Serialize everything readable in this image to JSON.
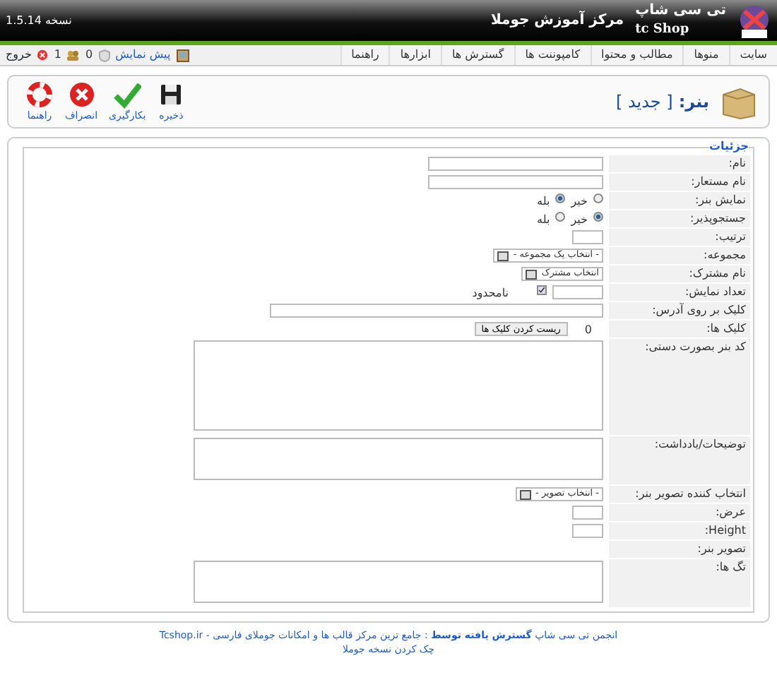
{
  "header": {
    "brand": "تی سی شاپ",
    "brand_latin": "tc Shop",
    "site": "مرکز آموزش جوملا",
    "version": "نسخه 1.5.14"
  },
  "menu": [
    "سایت",
    "منوها",
    "مطالب و محتوا",
    "کامپوننت ها",
    "گسترش ها",
    "ابزارها",
    "راهنما"
  ],
  "status": {
    "preview": "پیش نمایش",
    "messages": "0",
    "users": "1",
    "logout": "خروج"
  },
  "toolbar": {
    "title": "بنر:",
    "subtitle": "[ جدید ]",
    "buttons": [
      {
        "label": "ذخیره",
        "kind": "save"
      },
      {
        "label": "بکارگیری",
        "kind": "apply"
      },
      {
        "label": "انصراف",
        "kind": "cancel"
      },
      {
        "label": "راهنما",
        "kind": "help"
      }
    ]
  },
  "form": {
    "legend": "جزئیات",
    "rows": [
      {
        "kind": "text",
        "label": "نام:"
      },
      {
        "kind": "text",
        "label": "نام مستعار:"
      },
      {
        "kind": "radio",
        "label": "نمایش بنر:",
        "options": [
          {
            "label": "خیر",
            "selected": false
          },
          {
            "label": "بله",
            "selected": true
          }
        ]
      },
      {
        "kind": "radio",
        "label": "جستجوپذیر:",
        "options": [
          {
            "label": "خیر",
            "selected": true
          },
          {
            "label": "بله",
            "selected": false
          }
        ]
      },
      {
        "kind": "short",
        "label": "ترتیب:"
      },
      {
        "kind": "select",
        "label": "مجموعه:",
        "value": "- انتخاب یک مجموعه -"
      },
      {
        "kind": "select",
        "label": "نام مشترک:",
        "value": "انتخاب مشترک"
      },
      {
        "kind": "limit",
        "label": "تعداد نمایش:",
        "check_label": "نامحدود",
        "checked": true
      },
      {
        "kind": "wide",
        "label": "کلیک بر روی آدرس:"
      },
      {
        "kind": "clicks",
        "label": "کلیک ها:",
        "value": "0",
        "button": "ریست کردن کلیک ها"
      },
      {
        "kind": "codearea",
        "label": "کد بنر بصورت دستی:"
      },
      {
        "kind": "textarea",
        "label": "توضیحات/یادداشت:"
      },
      {
        "kind": "select",
        "label": "انتخاب کننده تصویر بنر:",
        "value": "- انتخاب تصویر -"
      },
      {
        "kind": "short",
        "label": "عرض:"
      },
      {
        "kind": "short",
        "label": "Height:"
      },
      {
        "kind": "empty",
        "label": "تصویر بنر:"
      },
      {
        "kind": "textarea",
        "label": "تگ ها:"
      }
    ]
  },
  "footer": {
    "credit": "انجمن تی سی شاپ **گسترش یافته توسط** : جامع ترین مرکز قالب ها و امکانات جوملای فارسی - Tcshop.ir",
    "check": "چک کردن نسخه جوملا"
  }
}
